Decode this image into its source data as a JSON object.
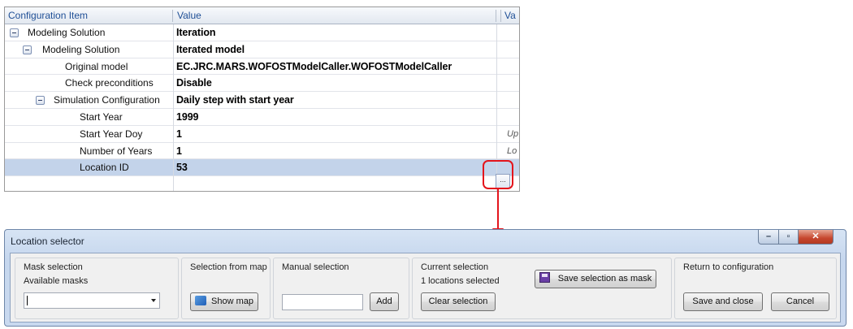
{
  "grid": {
    "columns": [
      "Configuration Item",
      "Value",
      "Va"
    ],
    "rows": [
      {
        "label": "Modeling Solution",
        "value": "Iteration",
        "indent": 0,
        "expander": true,
        "extra": ""
      },
      {
        "label": "Modeling Solution",
        "value": "Iterated model",
        "indent": 1,
        "expander": true,
        "extra": ""
      },
      {
        "label": "Original model",
        "value": "EC.JRC.MARS.WOFOSTModelCaller.WOFOSTModelCaller",
        "indent": 2,
        "expander": false,
        "extra": ""
      },
      {
        "label": "Check preconditions",
        "value": "Disable",
        "indent": 2,
        "expander": false,
        "extra": ""
      },
      {
        "label": "Simulation Configuration",
        "value": "Daily step with start year",
        "indent": 2,
        "expander": true,
        "extra": ""
      },
      {
        "label": "Start Year",
        "value": "1999",
        "indent": 3,
        "expander": false,
        "extra": ""
      },
      {
        "label": "Start Year Doy",
        "value": "1",
        "indent": 3,
        "expander": false,
        "extra": "Up"
      },
      {
        "label": "Number of Years",
        "value": "1",
        "indent": 3,
        "expander": false,
        "extra": "Lo"
      },
      {
        "label": "Location ID",
        "value": "53",
        "indent": 3,
        "expander": false,
        "extra": "",
        "selected": true
      }
    ],
    "ellipsis_label": "..."
  },
  "window": {
    "title": "Location selector",
    "mask_selection": {
      "title": "Mask selection",
      "available_label": "Available masks",
      "combo_value": ""
    },
    "map_selection": {
      "title": "Selection from map",
      "button": "Show map"
    },
    "manual_selection": {
      "title": "Manual selection",
      "input_value": "",
      "button": "Add"
    },
    "current_selection": {
      "title": "Current selection",
      "status": "1 locations selected",
      "save_mask_button": "Save selection as mask",
      "clear_button": "Clear selection"
    },
    "return_config": {
      "title": "Return to configuration",
      "save_button": "Save and close",
      "cancel_button": "Cancel"
    }
  },
  "colors": {
    "highlight": "#e4141c",
    "selected_row": "#c3d3ea",
    "header_text": "#1f4f96"
  }
}
